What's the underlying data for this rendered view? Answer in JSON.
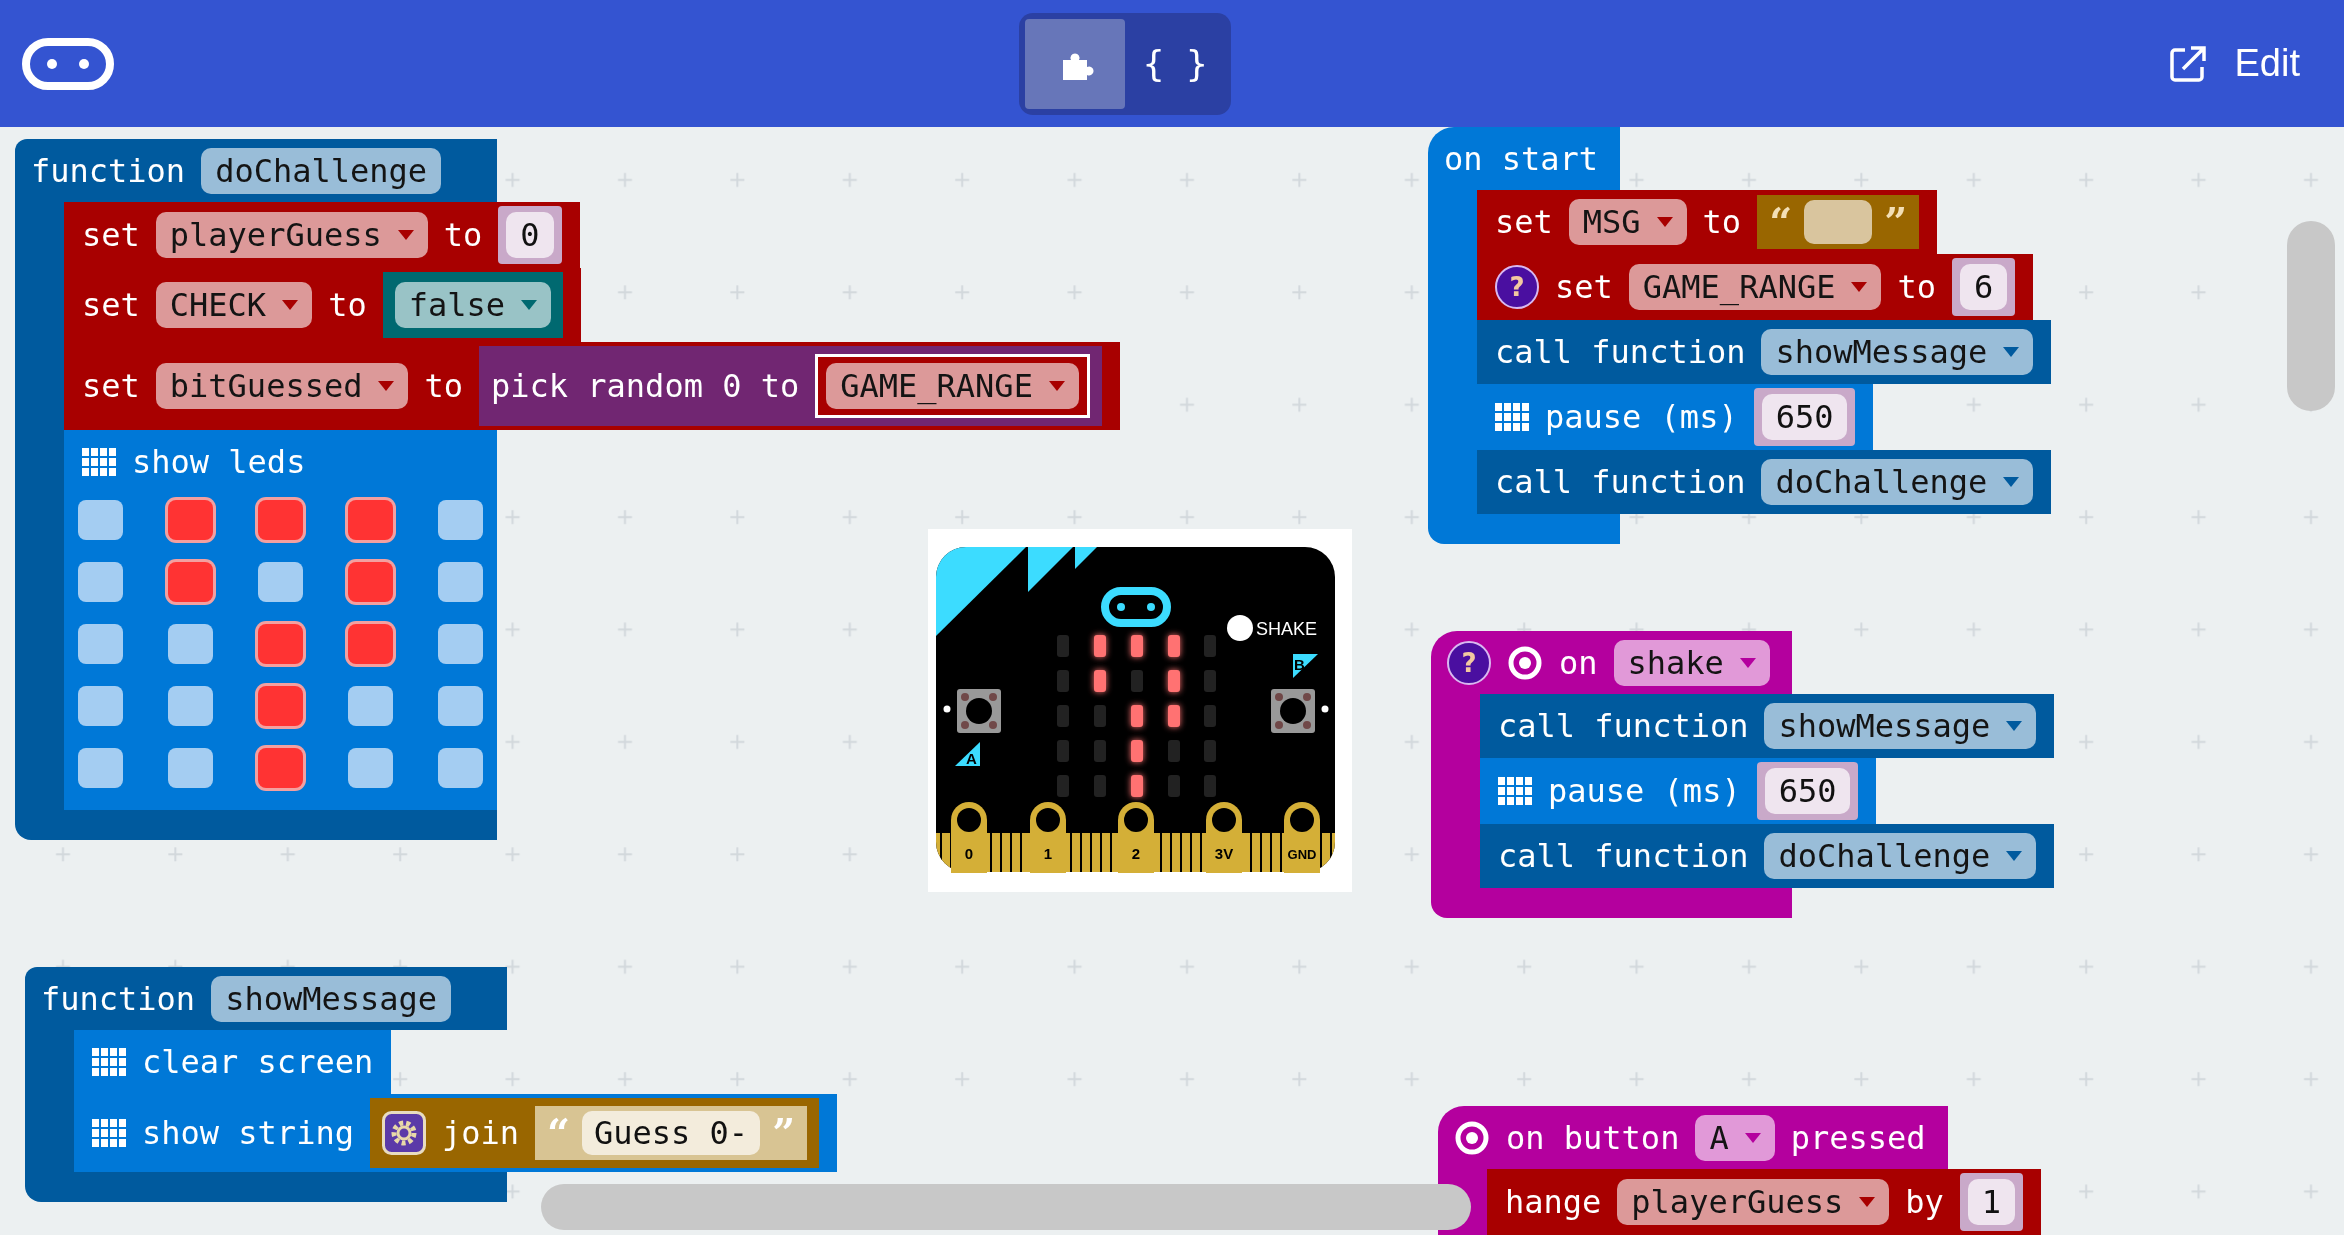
{
  "toolbar": {
    "toggle": [
      {
        "kind": "blocks",
        "selected": true
      },
      {
        "kind": "javascript",
        "label": "{ }",
        "selected": false
      }
    ],
    "edit_label": "Edit"
  },
  "stacks": [
    {
      "kind": "function",
      "color": "#005a9e",
      "header": [
        {
          "kind": "label",
          "text": "function"
        },
        {
          "kind": "name",
          "text": "doChallenge"
        }
      ],
      "blocks": [
        {
          "kind": "statement",
          "color": "#a80000",
          "parts": [
            {
              "kind": "label",
              "text": "set"
            },
            {
              "kind": "dropdown",
              "text": "playerGuess"
            },
            {
              "kind": "label",
              "text": "to"
            },
            {
              "kind": "number",
              "text": "0"
            }
          ]
        },
        {
          "kind": "statement",
          "color": "#a80000",
          "parts": [
            {
              "kind": "label",
              "text": "set"
            },
            {
              "kind": "dropdown",
              "text": "CHECK"
            },
            {
              "kind": "label",
              "text": "to"
            },
            {
              "kind": "reporter",
              "color": "#006970",
              "parts": [
                {
                  "kind": "dropdown",
                  "text": "false"
                }
              ]
            }
          ]
        },
        {
          "kind": "statement",
          "color": "#a80000",
          "parts": [
            {
              "kind": "label",
              "text": "set"
            },
            {
              "kind": "dropdown",
              "text": "bitGuessed"
            },
            {
              "kind": "label",
              "text": "to"
            },
            {
              "kind": "reporter",
              "color": "#712672",
              "parts": [
                {
                  "kind": "label",
                  "text": "pick random 0 to"
                },
                {
                  "kind": "reporter",
                  "color": "#a80000",
                  "outlined": true,
                  "parts": [
                    {
                      "kind": "dropdown",
                      "text": "GAME_RANGE"
                    }
                  ]
                }
              ]
            }
          ]
        },
        {
          "kind": "leds",
          "color": "#0078d7",
          "parts": [
            {
              "kind": "grid-icon"
            },
            {
              "kind": "label",
              "text": "show leds"
            }
          ],
          "leds": [
            [
              false,
              true,
              true,
              true,
              false
            ],
            [
              false,
              true,
              false,
              true,
              false
            ],
            [
              false,
              false,
              true,
              true,
              false
            ],
            [
              false,
              false,
              true,
              false,
              false
            ],
            [
              false,
              false,
              true,
              false,
              false
            ]
          ]
        }
      ]
    },
    {
      "kind": "event",
      "color": "#0078d7",
      "header": [
        {
          "kind": "label",
          "text": "on start"
        }
      ],
      "blocks": [
        {
          "kind": "statement",
          "color": "#a80000",
          "parts": [
            {
              "kind": "label",
              "text": "set"
            },
            {
              "kind": "dropdown",
              "text": "MSG"
            },
            {
              "kind": "label",
              "text": "to"
            },
            {
              "kind": "string",
              "open": "“",
              "close": "”",
              "shadow": false
            }
          ]
        },
        {
          "kind": "statement",
          "color": "#a80000",
          "parts": [
            {
              "kind": "help",
              "text": "?"
            },
            {
              "kind": "label",
              "text": "set"
            },
            {
              "kind": "dropdown",
              "text": "GAME_RANGE"
            },
            {
              "kind": "label",
              "text": "to"
            },
            {
              "kind": "number",
              "text": "6"
            }
          ]
        },
        {
          "kind": "statement",
          "color": "#005a9e",
          "parts": [
            {
              "kind": "label",
              "text": "call function"
            },
            {
              "kind": "dropdown",
              "text": "showMessage"
            }
          ]
        },
        {
          "kind": "statement",
          "color": "#0078d7",
          "parts": [
            {
              "kind": "grid-icon"
            },
            {
              "kind": "label",
              "text": "pause (ms)"
            },
            {
              "kind": "number",
              "text": "650"
            }
          ]
        },
        {
          "kind": "statement",
          "color": "#005a9e",
          "parts": [
            {
              "kind": "label",
              "text": "call function"
            },
            {
              "kind": "dropdown",
              "text": "doChallenge"
            }
          ]
        }
      ]
    },
    {
      "kind": "event",
      "color": "#b4009e",
      "header": [
        {
          "kind": "help",
          "text": "?"
        },
        {
          "kind": "target-icon"
        },
        {
          "kind": "label",
          "text": "on"
        },
        {
          "kind": "dropdown",
          "text": "shake"
        }
      ],
      "blocks": [
        {
          "kind": "statement",
          "color": "#005a9e",
          "parts": [
            {
              "kind": "label",
              "text": "call function"
            },
            {
              "kind": "dropdown",
              "text": "showMessage"
            }
          ]
        },
        {
          "kind": "statement",
          "color": "#0078d7",
          "parts": [
            {
              "kind": "grid-icon"
            },
            {
              "kind": "label",
              "text": "pause (ms)"
            },
            {
              "kind": "number",
              "text": "650"
            }
          ]
        },
        {
          "kind": "statement",
          "color": "#005a9e",
          "parts": [
            {
              "kind": "label",
              "text": "call function"
            },
            {
              "kind": "dropdown",
              "text": "doChallenge"
            }
          ]
        }
      ]
    },
    {
      "kind": "function",
      "color": "#005a9e",
      "header": [
        {
          "kind": "label",
          "text": "function"
        },
        {
          "kind": "name",
          "text": "showMessage"
        }
      ],
      "blocks": [
        {
          "kind": "statement",
          "color": "#0078d7",
          "parts": [
            {
              "kind": "grid-icon"
            },
            {
              "kind": "label",
              "text": "clear screen"
            }
          ]
        },
        {
          "kind": "statement",
          "color": "#0078d7",
          "parts": [
            {
              "kind": "grid-icon"
            },
            {
              "kind": "label",
              "text": "show string"
            },
            {
              "kind": "reporter",
              "color": "#996600",
              "parts": [
                {
                  "kind": "gear-icon"
                },
                {
                  "kind": "label",
                  "text": "join"
                },
                {
                  "kind": "string",
                  "open": "“",
                  "value": "Guess 0-",
                  "close": "”",
                  "shadow": true
                }
              ]
            }
          ]
        }
      ]
    },
    {
      "kind": "event",
      "color": "#b4009e",
      "header": [
        {
          "kind": "target-icon"
        },
        {
          "kind": "label",
          "text": "on button"
        },
        {
          "kind": "dropdown",
          "text": "A"
        },
        {
          "kind": "label",
          "text": "pressed"
        }
      ],
      "blocks": [
        {
          "kind": "statement",
          "color": "#a80000",
          "parts": [
            {
              "kind": "label",
              "text": "hange"
            },
            {
              "kind": "dropdown",
              "text": "playerGuess"
            },
            {
              "kind": "label",
              "text": "by"
            },
            {
              "kind": "number",
              "text": "1"
            }
          ]
        }
      ]
    }
  ],
  "simulator": {
    "leds": [
      [
        false,
        true,
        true,
        true,
        false
      ],
      [
        false,
        true,
        false,
        true,
        false
      ],
      [
        false,
        false,
        true,
        true,
        false
      ],
      [
        false,
        false,
        true,
        false,
        false
      ],
      [
        false,
        false,
        true,
        false,
        false
      ]
    ],
    "shake_label": "SHAKE",
    "button_labels": [
      "A",
      "B"
    ],
    "pins": [
      "0",
      "1",
      "2",
      "3V",
      "GND"
    ]
  }
}
